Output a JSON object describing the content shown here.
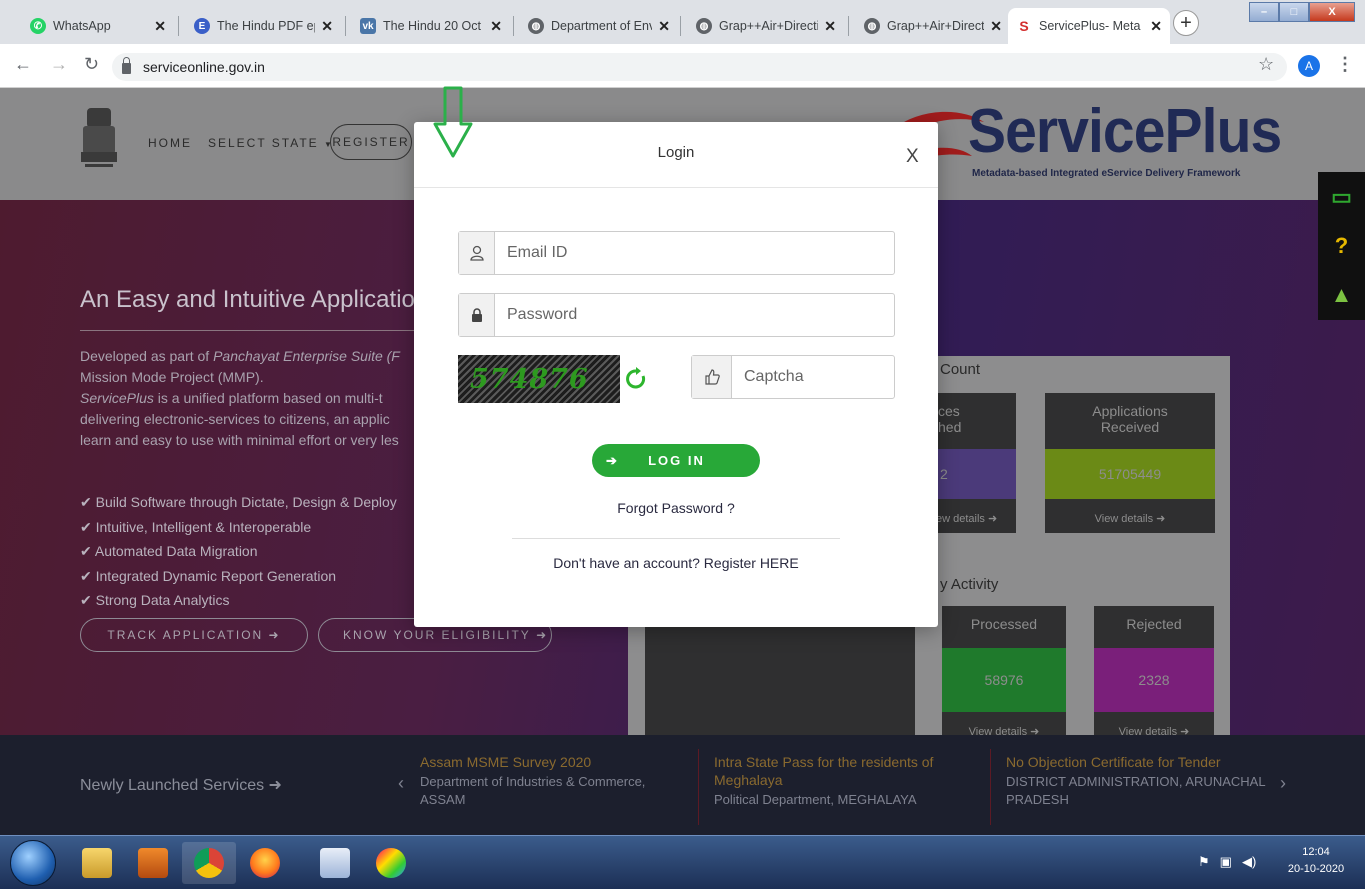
{
  "browser": {
    "tabs": [
      {
        "title": "WhatsApp",
        "favicon": "whatsapp-icon",
        "color": "#25d366"
      },
      {
        "title": "The Hindu PDF epa",
        "favicon": "e-icon",
        "color": "#3a5fc8"
      },
      {
        "title": "The Hindu 20 Oct 2",
        "favicon": "vk-icon",
        "color": "#4a76a8"
      },
      {
        "title": "Department of Env",
        "favicon": "globe-icon",
        "color": "#5f6368"
      },
      {
        "title": "Grap++Air+Directi",
        "favicon": "globe-icon",
        "color": "#5f6368"
      },
      {
        "title": "Grap++Air+Directi",
        "favicon": "globe-icon",
        "color": "#5f6368"
      },
      {
        "title": "ServicePlus- Meta",
        "favicon": "serviceplus-icon",
        "color": "#d32f2f"
      }
    ],
    "url": "serviceonline.gov.in",
    "profile_initial": "A"
  },
  "site": {
    "nav": {
      "home": "HOME",
      "select_state": "SELECT STATE",
      "register": "REGISTER"
    },
    "emblem_motto": "सत्यमेव जयते",
    "logo": {
      "name": "ServicePlus",
      "tagline": "Metadata-based Integrated eService Delivery Framework"
    },
    "hero": {
      "title": "An Easy and Intuitive Application",
      "para1_a": "Developed as part of ",
      "para1_b": "Panchayat Enterprise Suite (F",
      "para1_c": "Mission Mode Project (MMP).",
      "para2_a": "ServicePlus",
      "para2_b": " is a unified platform based on multi-t",
      "para2_c": "delivering electronic-services to citizens, an applic",
      "para2_d": "learn and easy to use with minimal effort or very les",
      "features": [
        "Build Software through Dictate, Design & Deploy",
        "Intuitive, Intelligent & Interoperable",
        "Automated Data Migration",
        "Integrated Dynamic Report Generation",
        "Strong Data Analytics"
      ],
      "track_btn": "TRACK APPLICATION",
      "eligibility_btn": "KNOW YOUR ELIGIBILITY"
    },
    "stats": {
      "count_heading": "Count",
      "activity_heading": "y Activity",
      "services": {
        "label": "ces\nhed",
        "value": "2",
        "view": "ew details"
      },
      "received": {
        "label": "Applications\nReceived",
        "value": "51705449",
        "view": "View details"
      },
      "processed": {
        "label": "Processed",
        "value": "58976",
        "view": "View details"
      },
      "rejected": {
        "label": "Rejected",
        "value": "2328",
        "view": "View details"
      },
      "colors": {
        "received": "#6b8a16",
        "processed": "#1f7a2c",
        "rejected": "#7a1f7a",
        "services": "#4b3a7a"
      }
    },
    "newly_launched": {
      "title": "Newly Launched Services",
      "items": [
        {
          "title": "Assam MSME Survey 2020",
          "dept": "Department of Industries & Commerce, ASSAM"
        },
        {
          "title": "Intra State Pass for the residents of Meghalaya",
          "dept": "Political Department, MEGHALAYA"
        },
        {
          "title": "No Objection Certificate for Tender",
          "dept": "DISTRICT ADMINISTRATION, ARUNACHAL PRADESH"
        }
      ]
    }
  },
  "login_modal": {
    "title": "Login",
    "close": "X",
    "email_placeholder": "Email ID",
    "password_placeholder": "Password",
    "captcha_code": "574876",
    "captcha_placeholder": "Captcha",
    "login_button": "LOG IN",
    "forgot": "Forgot Password ?",
    "register": "Don't have an account? Register HERE"
  },
  "taskbar": {
    "time": "12:04",
    "date": "20-10-2020"
  }
}
